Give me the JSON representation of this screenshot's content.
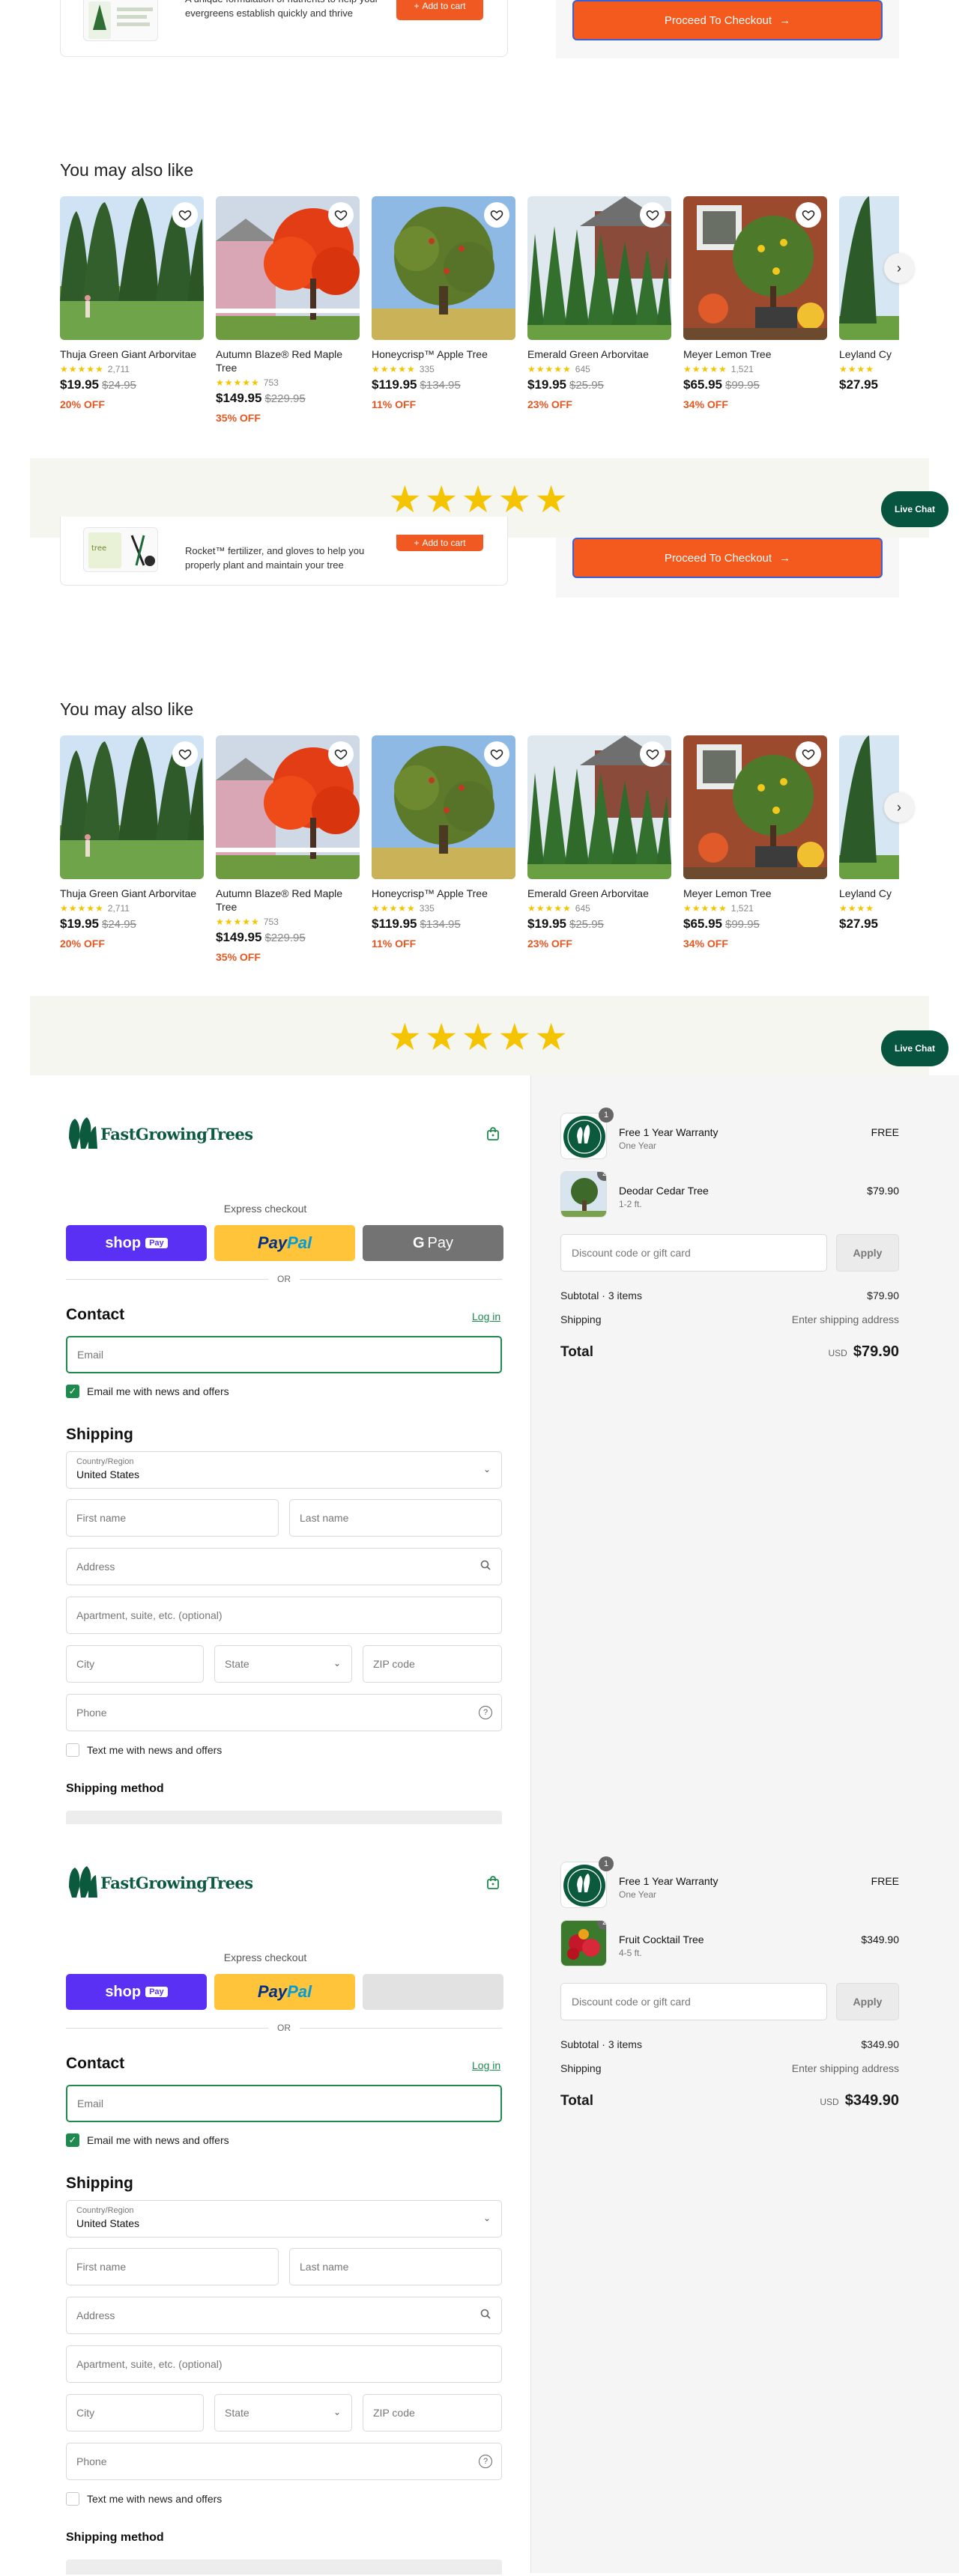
{
  "colors": {
    "accent_orange": "#f05a22",
    "brand_green": "#0b5a3e",
    "star": "#f5c400",
    "discount": "#e8551f",
    "shop_pay": "#5a31f4",
    "paypal": "#ffc439"
  },
  "upsell": {
    "desc_a": "A unique formulation of nutrients to help your evergreens establish quickly and thrive",
    "desc_b": "Rocket™ fertilizer, and gloves to help you properly plant and maintain your tree",
    "add_to_cart": "Add to cart",
    "checkout": "Proceed To Checkout"
  },
  "recs": {
    "title": "You may also like",
    "items": [
      {
        "name": "Thuja Green Giant Arborvitae",
        "stars": "★★★★★",
        "count": "2,711",
        "price": "$19.95",
        "was": "$24.95",
        "off": "20% OFF"
      },
      {
        "name": "Autumn Blaze® Red Maple Tree",
        "stars": "★★★★★",
        "count": "753",
        "price": "$149.95",
        "was": "$229.95",
        "off": "35% OFF"
      },
      {
        "name": "Honeycrisp™ Apple Tree",
        "stars": "★★★★★",
        "count": "335",
        "price": "$119.95",
        "was": "$134.95",
        "off": "11% OFF"
      },
      {
        "name": "Emerald Green Arborvitae",
        "stars": "★★★★★",
        "count": "645",
        "price": "$19.95",
        "was": "$25.95",
        "off": "23% OFF"
      },
      {
        "name": "Meyer Lemon Tree",
        "stars": "★★★★★",
        "count": "1,521",
        "price": "$65.95",
        "was": "$99.95",
        "off": "34% OFF"
      },
      {
        "name": "Leyland Cy",
        "stars": "★★★★",
        "count": "",
        "price": "$27.95",
        "was": "",
        "off": ""
      }
    ]
  },
  "reviews": {
    "stars": "★★★★★"
  },
  "live_chat": "Live Chat",
  "checkout": {
    "logo": "FastGrowingTrees",
    "express": "Express checkout",
    "shop_pay": "shop",
    "shop_pay_tag": "Pay",
    "paypal_a": "Pay",
    "paypal_b": "Pal",
    "gpay_g": "G",
    "gpay_pay": "Pay",
    "or": "OR",
    "contact": "Contact",
    "login": "Log in",
    "email_ph": "Email",
    "email_news": "Email me with news and offers",
    "shipping": "Shipping",
    "country_label": "Country/Region",
    "country": "United States",
    "first_name": "First name",
    "last_name": "Last name",
    "address": "Address",
    "apartment": "Apartment, suite, etc. (optional)",
    "city": "City",
    "state": "State",
    "zip": "ZIP code",
    "phone": "Phone",
    "text_news": "Text me with news and offers",
    "shipping_method": "Shipping method"
  },
  "summary_a": {
    "items": [
      {
        "qty": "1",
        "name": "Free 1 Year Warranty",
        "variant": "One Year",
        "price": "FREE"
      },
      {
        "qty": "2",
        "name": "Deodar Cedar Tree",
        "variant": "1-2 ft.",
        "price": "$79.90"
      }
    ],
    "discount_ph": "Discount code or gift card",
    "apply": "Apply",
    "subtotal_label": "Subtotal · 3 items",
    "subtotal": "$79.90",
    "shipping_label": "Shipping",
    "shipping_val": "Enter shipping address",
    "total_label": "Total",
    "currency": "USD",
    "total": "$79.90"
  },
  "summary_b": {
    "items": [
      {
        "qty": "1",
        "name": "Free 1 Year Warranty",
        "variant": "One Year",
        "price": "FREE"
      },
      {
        "qty": "2",
        "name": "Fruit Cocktail Tree",
        "variant": "4-5 ft.",
        "price": "$349.90"
      }
    ],
    "discount_ph": "Discount code or gift card",
    "apply": "Apply",
    "subtotal_label": "Subtotal · 3 items",
    "subtotal": "$349.90",
    "shipping_label": "Shipping",
    "shipping_val": "Enter shipping address",
    "total_label": "Total",
    "currency": "USD",
    "total": "$349.90"
  }
}
